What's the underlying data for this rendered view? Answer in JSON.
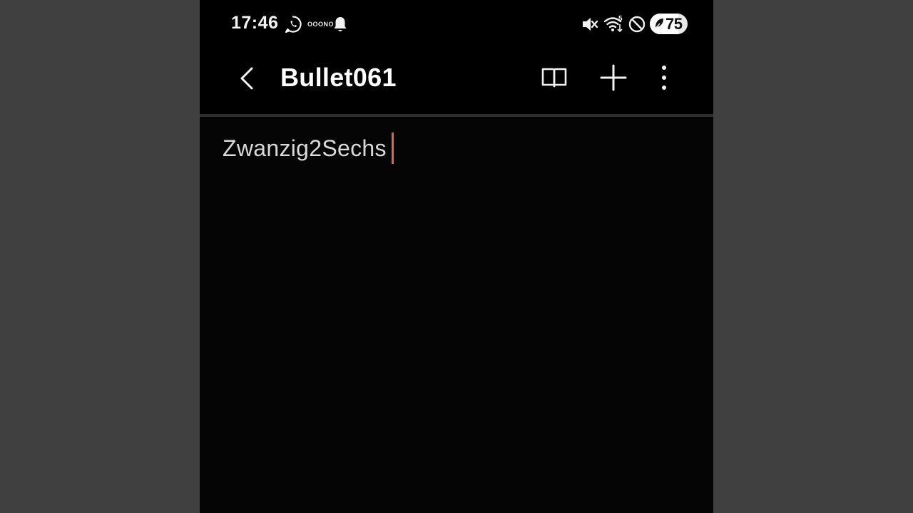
{
  "status_bar": {
    "time": "17:46",
    "notification_icons": [
      "whatsapp-icon",
      "mini-text-icon",
      "bell-icon"
    ],
    "mini_text": "OOONO",
    "system_icons": [
      "mute-icon",
      "wifi-icon",
      "do-not-disturb-icon"
    ],
    "wifi_label": "5",
    "battery_level": "75",
    "battery_percent": 75
  },
  "app_bar": {
    "title": "Bullet061",
    "back_icon": "chevron-left-icon",
    "actions": [
      "book-icon",
      "plus-icon",
      "more-vert-icon"
    ]
  },
  "editor": {
    "text": "Zwanzig2Sechs"
  },
  "colors": {
    "caret": "#e8604c",
    "background": "#050505",
    "outer_background": "#404040"
  }
}
